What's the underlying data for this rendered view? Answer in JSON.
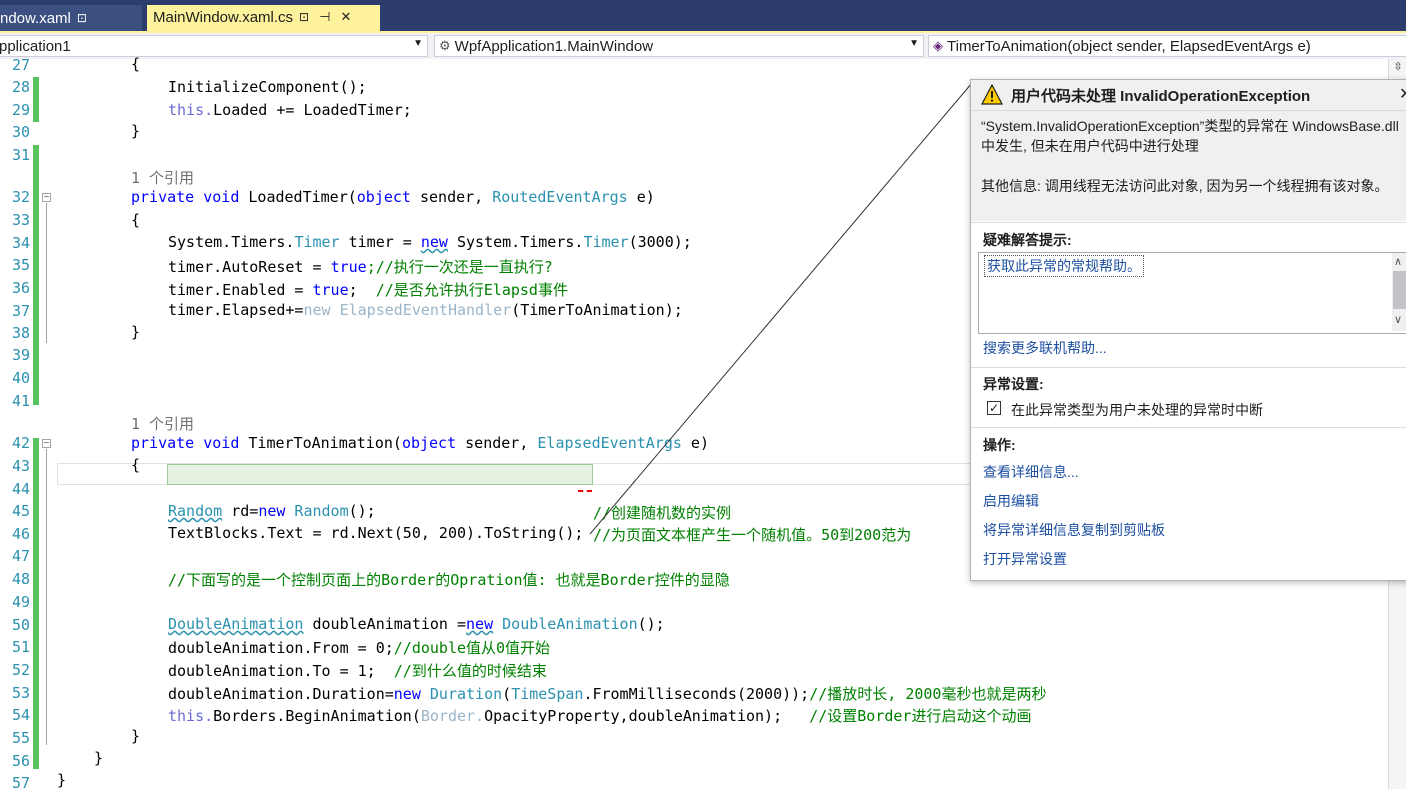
{
  "tabs": [
    {
      "label": "ndow.xaml",
      "pin": "⊡"
    },
    {
      "label": "MainWindow.xaml.cs",
      "pin": "⊡",
      "dock": "⊣",
      "close": "✕"
    }
  ],
  "nav": {
    "project": "pplication1",
    "class": "WpfApplication1.MainWindow",
    "member": "TimerToAnimation(object sender, ElapsedEventArgs e)"
  },
  "editor": {
    "line_numbers": [
      "27",
      "28",
      "29",
      "30",
      "31",
      "32",
      "33",
      "34",
      "35",
      "36",
      "37",
      "38",
      "39",
      "40",
      "41",
      "42",
      "43",
      "44",
      "45",
      "46",
      "47",
      "48",
      "49",
      "50",
      "51",
      "52",
      "53",
      "54",
      "55",
      "56",
      "57"
    ],
    "ref1": "1 个引用",
    "ref2": "1 个引用",
    "l27": "{",
    "l28": "InitializeComponent();",
    "l29_this": "this.",
    "l29_rest": "Loaded += LoadedTimer;",
    "l30": "}",
    "l32_kw": "private void ",
    "l32_name": "LoadedTimer(",
    "l32_obj": "object",
    "l32_sender": " sender, ",
    "l32_type": "RoutedEventArgs",
    "l32_end": " e)",
    "l33": "{",
    "l34_a": "System.Timers.",
    "l34_t1": "Timer",
    "l34_b": " timer = ",
    "l34_new": "new",
    "l34_c": " System.Timers.",
    "l34_t2": "Timer",
    "l34_d": "(3000);",
    "l35_a": "timer.AutoReset = ",
    "l35_true": "true",
    "l35_cm": ";//执行一次还是一直执行?",
    "l36_a": "timer.Enabled = ",
    "l36_true": "true",
    "l36_b": ";  ",
    "l36_cm": "//是否允许执行Elapsd事件",
    "l37_a": "timer.Elapsed+=",
    "l37_gy": "new ElapsedEventHandler",
    "l37_b": "(TimerToAnimation);",
    "l38": "}",
    "l42_kw": "private void ",
    "l42_name": "TimerToAnimation(",
    "l42_obj": "object",
    "l42_sender": " sender, ",
    "l42_type": "ElapsedEventArgs",
    "l42_end": " e)",
    "l43": "{",
    "l45_ty": "Random",
    "l45_a": " rd=",
    "l45_new": "new",
    "l45_ty2": " Random",
    "l45_b": "();",
    "l45_cm": "//创建随机数的实例",
    "l46_code": "TextBlocks.Text = rd.Next(50, 200).ToString();",
    "l46_cm": "//为页面文本框产生一个随机值。50到200范为",
    "l48_cm": "//下面写的是一个控制页面上的Border的Opration值: 也就是Border控件的显隐",
    "l50_ty": "DoubleAnimation",
    "l50_a": " doubleAnimation =",
    "l50_new": "new",
    "l50_ty2": " DoubleAnimation",
    "l50_b": "();",
    "l51_a": "doubleAnimation.From = 0;",
    "l51_cm": "//double值从0值开始",
    "l52_a": "doubleAnimation.To = 1;  ",
    "l52_cm": "//到什么值的时候结束",
    "l53_a": "doubleAnimation.Duration=",
    "l53_new": "new",
    "l53_ty": " Duration",
    "l53_b": "(",
    "l53_ty2": "TimeSpan",
    "l53_c": ".FromMilliseconds(2000));",
    "l53_cm": "//播放时长, 2000毫秒也就是两秒",
    "l54_this": "this.",
    "l54_a": "Borders.BeginAnimation(",
    "l54_gy": "Border.",
    "l54_b": "OpacityProperty,doubleAnimation);   ",
    "l54_cm": "//设置Border进行启动这个动画",
    "l55": "}",
    "l56": "}",
    "l57": "}"
  },
  "exception": {
    "title": "用户代码未处理 InvalidOperationException",
    "message": "“System.InvalidOperationException”类型的异常在 WindowsBase.dll 中发生, 但未在用户代码中进行处理",
    "extra": "其他信息: 调用线程无法访问此对象, 因为另一个线程拥有该对象。",
    "tips_heading": "疑难解答提示:",
    "tip_link": "获取此异常的常规帮助。",
    "search_link": "搜索更多联机帮助...",
    "settings_heading": "异常设置:",
    "break_checkbox": "在此异常类型为用户未处理的异常时中断",
    "break_checked": true,
    "actions_heading": "操作:",
    "actions": [
      "查看详细信息...",
      "启用编辑",
      "将异常详细信息复制到剪贴板",
      "打开异常设置"
    ]
  }
}
